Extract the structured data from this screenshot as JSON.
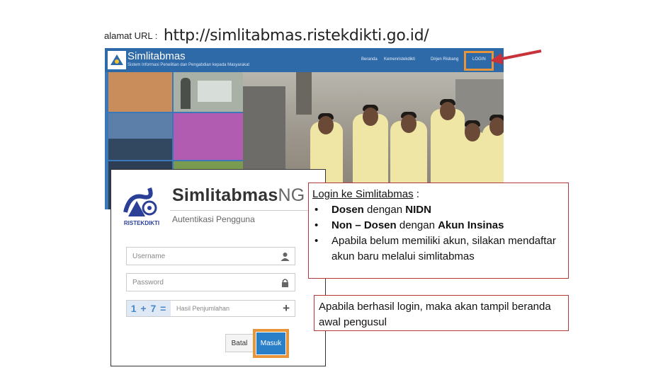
{
  "url_line": {
    "prefix": "alamat URL :",
    "url": "http://simlitabmas.ristekdikti.go.id/"
  },
  "site": {
    "brand": "Simlitabmas",
    "tagline": "Sistem Informasi Penelitian dan Pengabdian kepada Masyarakat",
    "nav": [
      "Beranda",
      "Kemenristekdikti",
      "Dirjen Risbang",
      "LOGIN"
    ],
    "highlight_color": "#e8943a",
    "header_color": "#2e69a8"
  },
  "login_card": {
    "logo_text": "RISTEKDIKTI",
    "brand_main": "Simlitabmas",
    "brand_suffix": "NG",
    "subtitle": "Autentikasi Pengguna",
    "username_placeholder": "Username",
    "password_placeholder": "Password",
    "captcha_equation": "1 + 7 =",
    "captcha_placeholder": "Hasil Penjumlahan",
    "batal_label": "Batal",
    "masuk_label": "Masuk",
    "accent_color": "#2a7fc9"
  },
  "note1": {
    "heading": "Login ke Simlitabmas",
    "heading_suffix": " :",
    "items": [
      {
        "pre": "",
        "bold1": "Dosen",
        "mid": " dengan ",
        "bold2": "NIDN"
      },
      {
        "pre": "",
        "bold1": "Non – Dosen",
        "mid": " dengan ",
        "bold2": "Akun Insinas"
      },
      {
        "pre": "Apabila belum memiliki akun, silakan mendaftar akun baru melalui simlitabmas",
        "bold1": "",
        "mid": "",
        "bold2": ""
      }
    ]
  },
  "note2": {
    "text": "Apabila berhasil login, maka akan tampil beranda awal pengusul"
  }
}
